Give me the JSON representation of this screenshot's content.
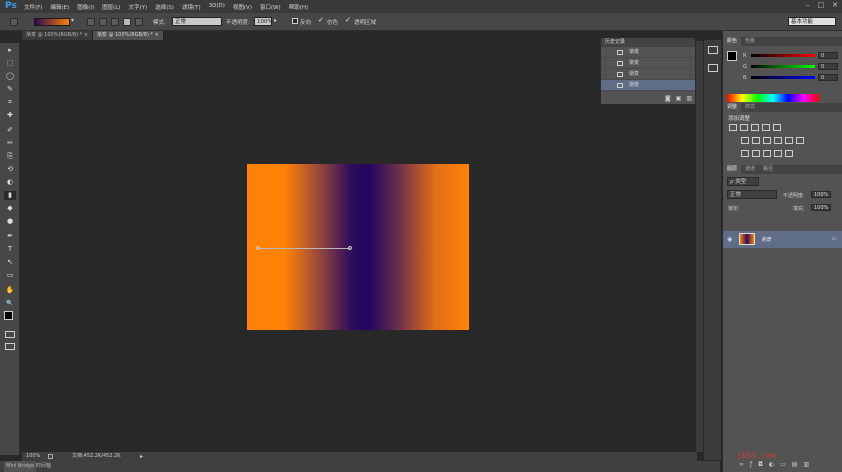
{
  "app": {
    "logo": "Ps"
  },
  "menu": [
    "文件(F)",
    "编辑(E)",
    "图像(I)",
    "图层(L)",
    "文字(Y)",
    "选择(S)",
    "滤镜(T)",
    "3D(D)",
    "视图(V)",
    "窗口(W)",
    "帮助(H)"
  ],
  "window_controls": [
    "–",
    "□",
    "✕"
  ],
  "options": {
    "mode_label": "模式:",
    "mode_value": "正常",
    "opacity_label": "不透明度:",
    "opacity_value": "100%",
    "reverse_label": "反向",
    "dither_label": "仿色",
    "transparency_label": "透明区域",
    "workspace": "基本功能"
  },
  "tabs": [
    {
      "label": "渐变 @ 100%(RGB/8) *",
      "close": "×"
    },
    {
      "label": "渐变 @ 100%(RGB/8) *",
      "close": "×"
    }
  ],
  "tools": [
    "▸",
    "⬚",
    "◯",
    "✎",
    "⌗",
    "✚",
    "✐",
    "✏",
    "⎘",
    "⟲",
    "◐",
    "▮",
    "◆",
    "●",
    "✒",
    "T",
    "↖",
    "▭",
    "✋",
    "🔍"
  ],
  "history": {
    "title": "历史记录",
    "items": [
      "渐变",
      "渐变",
      "渐变",
      "渐变"
    ],
    "selected_index": 3
  },
  "color_panel": {
    "tabs": [
      "颜色",
      "色板"
    ],
    "channels": [
      {
        "label": "R",
        "value": "0",
        "color": "#d03030"
      },
      {
        "label": "G",
        "value": "0",
        "color": "#30a030"
      },
      {
        "label": "B",
        "value": "0",
        "color": "#3050d0"
      }
    ]
  },
  "adjustments": {
    "tabs": [
      "调整",
      "样式"
    ],
    "title": "添加调整"
  },
  "layers": {
    "tabs": [
      "图层",
      "通道",
      "路径"
    ],
    "kind_label": "ρ 类型",
    "blend_mode": "正常",
    "opacity_label": "不透明度:",
    "opacity_value": "100%",
    "lock_label": "锁定:",
    "fill_label": "填充:",
    "fill_value": "100%",
    "layer_name": "背景"
  },
  "status": {
    "zoom": "100%",
    "doc_info": "文档:452.2K/452.2K"
  },
  "bottom": {
    "mini_bridge": "Mini Bridge",
    "timeline": "时间轴"
  },
  "watermark": "jb51.com",
  "gradient_colors": {
    "start": "#ff8206",
    "mid": "#220660",
    "end": "#ff8206"
  }
}
